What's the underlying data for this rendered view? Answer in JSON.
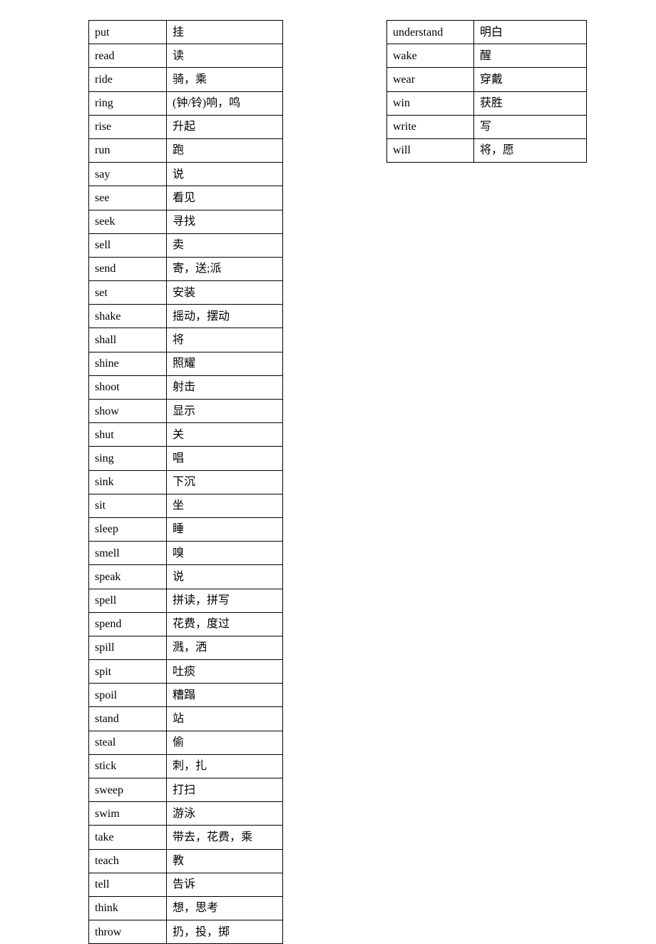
{
  "leftTable": [
    {
      "en": "put",
      "cn": "挂"
    },
    {
      "en": "read",
      "cn": "读"
    },
    {
      "en": "ride",
      "cn": "骑，乘"
    },
    {
      "en": "ring",
      "cn": "(钟/铃)响，鸣"
    },
    {
      "en": "rise",
      "cn": "升起"
    },
    {
      "en": "run",
      "cn": "跑"
    },
    {
      "en": "say",
      "cn": "说"
    },
    {
      "en": "see",
      "cn": "看见"
    },
    {
      "en": "seek",
      "cn": "寻找"
    },
    {
      "en": "sell",
      "cn": "卖"
    },
    {
      "en": "send",
      "cn": "寄，送;派"
    },
    {
      "en": "set",
      "cn": "安装"
    },
    {
      "en": "shake",
      "cn": "摇动，摆动"
    },
    {
      "en": "shall",
      "cn": "将"
    },
    {
      "en": "shine",
      "cn": "照耀"
    },
    {
      "en": "shoot",
      "cn": "射击"
    },
    {
      "en": "show",
      "cn": "显示"
    },
    {
      "en": "shut",
      "cn": "关"
    },
    {
      "en": "sing",
      "cn": "唱"
    },
    {
      "en": "sink",
      "cn": "下沉"
    },
    {
      "en": "sit",
      "cn": "坐"
    },
    {
      "en": "sleep",
      "cn": "睡"
    },
    {
      "en": "smell",
      "cn": "嗅"
    },
    {
      "en": "speak",
      "cn": "说"
    },
    {
      "en": "spell",
      "cn": "拼读，拼写"
    },
    {
      "en": "spend",
      "cn": "花费，度过"
    },
    {
      "en": "spill",
      "cn": "溅，洒"
    },
    {
      "en": "spit",
      "cn": "吐痰"
    },
    {
      "en": "spoil",
      "cn": "糟蹋"
    },
    {
      "en": "stand",
      "cn": "站"
    },
    {
      "en": "steal",
      "cn": "偷"
    },
    {
      "en": "stick",
      "cn": "刺，扎"
    },
    {
      "en": "sweep",
      "cn": "打扫"
    },
    {
      "en": "swim",
      "cn": "游泳"
    },
    {
      "en": "take",
      "cn": "带去，花费，乘"
    },
    {
      "en": "teach",
      "cn": "教"
    },
    {
      "en": "tell",
      "cn": "告诉"
    },
    {
      "en": "think",
      "cn": "想，思考"
    },
    {
      "en": "throw",
      "cn": "扔，投，掷"
    }
  ],
  "rightTable": [
    {
      "en": "understand",
      "cn": "明白"
    },
    {
      "en": "wake",
      "cn": "醒"
    },
    {
      "en": "wear",
      "cn": "穿戴"
    },
    {
      "en": "win",
      "cn": "获胜"
    },
    {
      "en": "write",
      "cn": "写"
    },
    {
      "en": "will",
      "cn": "将，愿"
    }
  ]
}
